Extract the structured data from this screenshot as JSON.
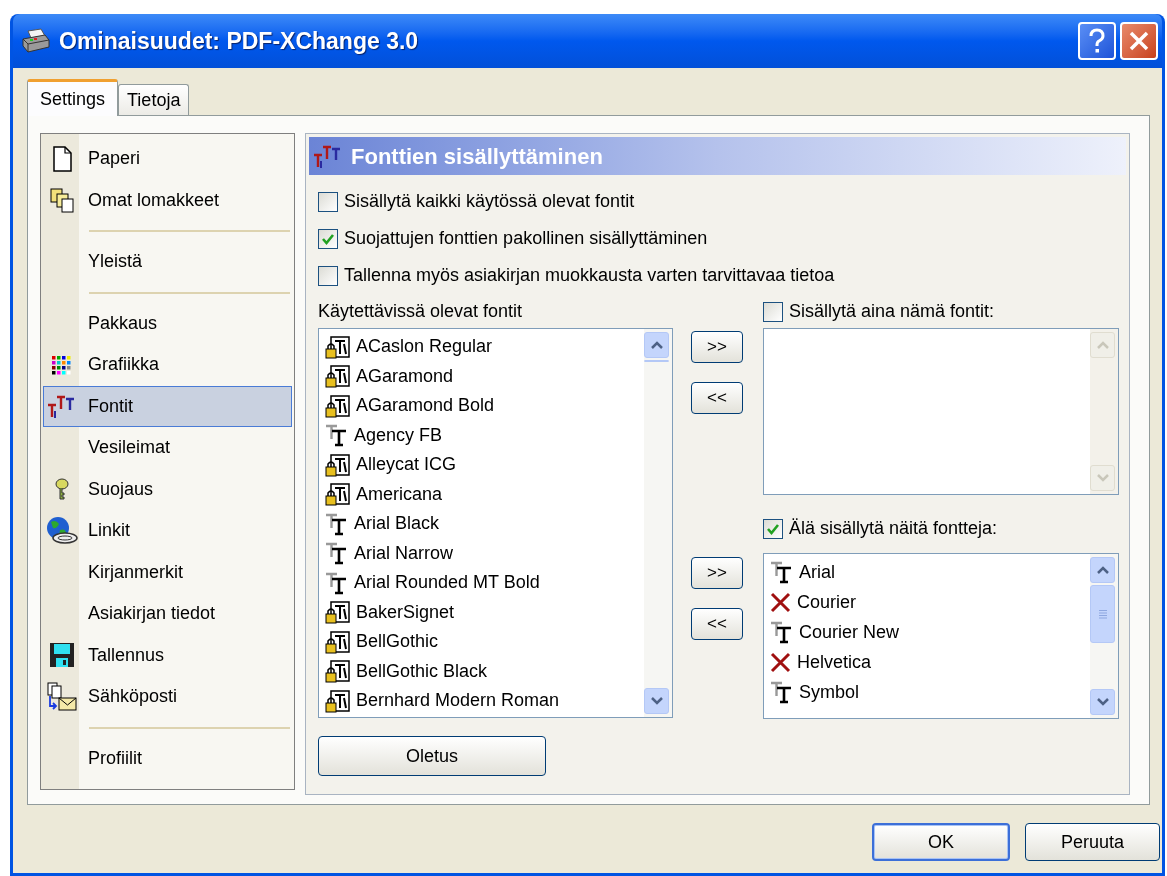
{
  "window": {
    "title": "Ominaisuudet: PDF-XChange 3.0"
  },
  "tabs": [
    {
      "label": "Settings",
      "selected": true
    },
    {
      "label": "Tietoja",
      "selected": false
    }
  ],
  "sidebar": {
    "items": [
      {
        "kind": "item",
        "label": "Paperi",
        "selected": false
      },
      {
        "kind": "item",
        "label": "Omat lomakkeet",
        "selected": false
      },
      {
        "kind": "separator"
      },
      {
        "kind": "item",
        "label": "Yleistä",
        "selected": false
      },
      {
        "kind": "separator"
      },
      {
        "kind": "item",
        "label": "Pakkaus",
        "selected": false
      },
      {
        "kind": "item",
        "label": "Grafiikka",
        "selected": false
      },
      {
        "kind": "item",
        "label": "Fontit",
        "selected": true
      },
      {
        "kind": "item",
        "label": "Vesileimat",
        "selected": false
      },
      {
        "kind": "item",
        "label": "Suojaus",
        "selected": false
      },
      {
        "kind": "item",
        "label": "Linkit",
        "selected": false
      },
      {
        "kind": "item",
        "label": "Kirjanmerkit",
        "selected": false
      },
      {
        "kind": "item",
        "label": "Asiakirjan tiedot",
        "selected": false
      },
      {
        "kind": "item",
        "label": "Tallennus",
        "selected": false
      },
      {
        "kind": "item",
        "label": "Sähköposti",
        "selected": false
      },
      {
        "kind": "separator"
      },
      {
        "kind": "item",
        "label": "Profiilit",
        "selected": false
      }
    ]
  },
  "panel": {
    "title": "Fonttien sisällyttäminen",
    "options": [
      {
        "label": "Sisällytä kaikki käytössä olevat fontit",
        "checked": false
      },
      {
        "label": "Suojattujen fonttien pakollinen sisällyttäminen",
        "checked": true
      },
      {
        "label": "Tallenna myös asiakirjan muokkausta varten tarvittavaa tietoa",
        "checked": false
      }
    ],
    "available": {
      "label": "Käytettävissä olevat fontit",
      "fonts": [
        {
          "name": "ACaslon Regular",
          "kind": "type1"
        },
        {
          "name": "AGaramond",
          "kind": "type1"
        },
        {
          "name": "AGaramond Bold",
          "kind": "type1"
        },
        {
          "name": "Agency FB",
          "kind": "truetype"
        },
        {
          "name": "Alleycat ICG",
          "kind": "type1"
        },
        {
          "name": "Americana",
          "kind": "type1"
        },
        {
          "name": "Arial Black",
          "kind": "truetype"
        },
        {
          "name": "Arial Narrow",
          "kind": "truetype"
        },
        {
          "name": "Arial Rounded MT Bold",
          "kind": "truetype"
        },
        {
          "name": "BakerSignet",
          "kind": "type1"
        },
        {
          "name": "BellGothic",
          "kind": "type1"
        },
        {
          "name": "BellGothic Black",
          "kind": "type1"
        },
        {
          "name": "Bernhard Modern Roman",
          "kind": "type1"
        }
      ]
    },
    "transfer_buttons": [
      {
        "label": ">>"
      },
      {
        "label": "<<"
      },
      {
        "label": ">>"
      },
      {
        "label": "<<"
      }
    ],
    "always_include": {
      "label": "Sisällytä aina nämä fontit:",
      "checked": false
    },
    "exclude": {
      "label": "Älä sisällytä näitä fontteja:",
      "checked": true,
      "fonts": [
        {
          "name": "Arial",
          "kind": "truetype"
        },
        {
          "name": "Courier",
          "kind": "missing"
        },
        {
          "name": "Courier New",
          "kind": "truetype"
        },
        {
          "name": "Helvetica",
          "kind": "missing"
        },
        {
          "name": "Symbol",
          "kind": "truetype"
        }
      ]
    },
    "default_button": "Oletus"
  },
  "buttons": [
    {
      "label": "OK",
      "default": true
    },
    {
      "label": "Peruuta",
      "default": false
    }
  ]
}
